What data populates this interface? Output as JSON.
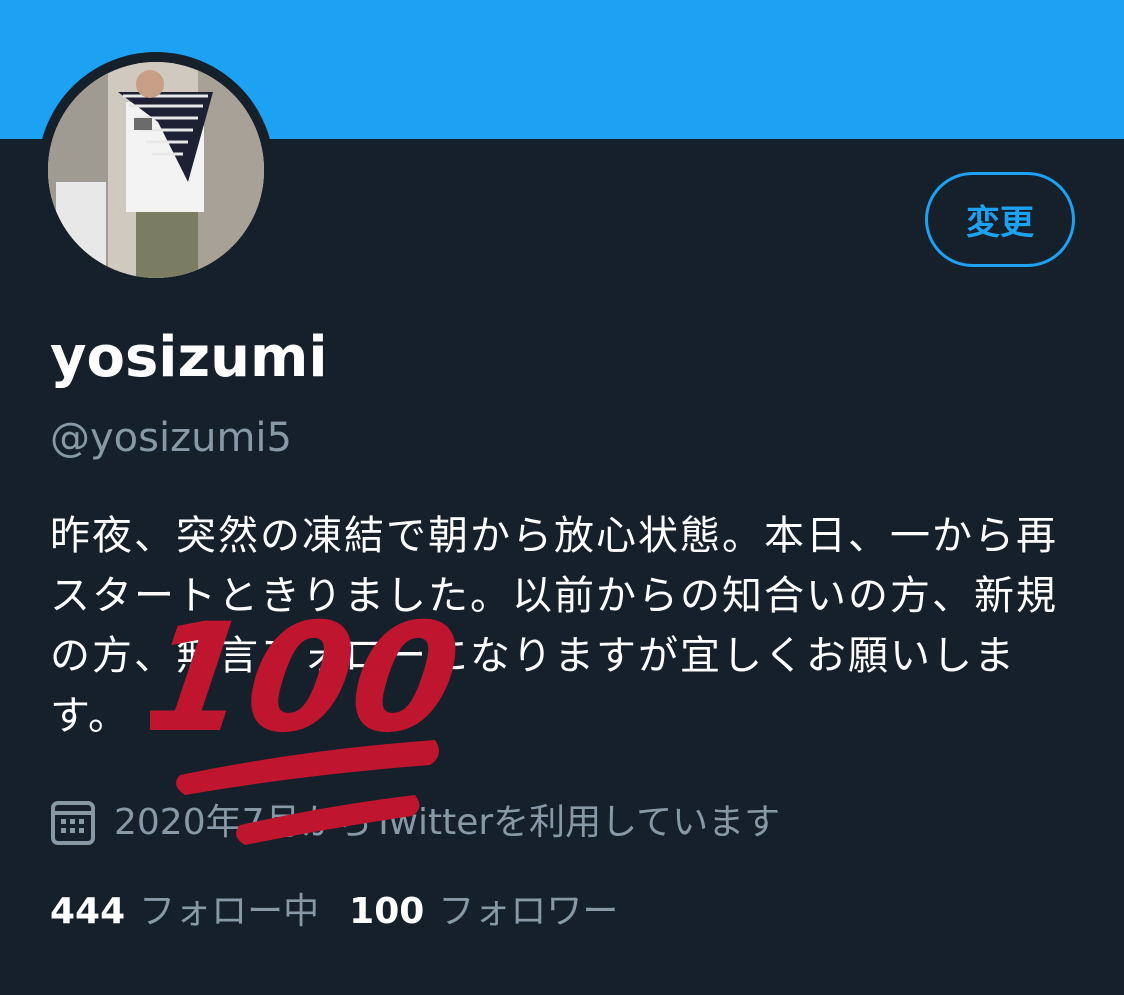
{
  "profile": {
    "display_name": "yosizumi",
    "handle": "@yosizumi5",
    "bio": "昨夜、突然の凍結で朝から放心状態。本日、一から再スタートときりました。以前からの知合いの方、新規の方、無言フォローになりますが宜しくお願いします。",
    "joined": "2020年7月からTwitterを利用しています"
  },
  "actions": {
    "edit_label": "変更"
  },
  "stats": {
    "following_count": "444",
    "following_label": "フォロー中",
    "followers_count": "100",
    "followers_label": "フォロワー"
  },
  "overlay": {
    "emoji_text": "100"
  },
  "colors": {
    "banner": "#1da1f2",
    "background": "#15202b",
    "secondary_text": "#8899a6",
    "emoji_red": "#c0152f"
  },
  "icons": {
    "calendar": "calendar-icon",
    "emoji": "hundred-points-emoji"
  }
}
